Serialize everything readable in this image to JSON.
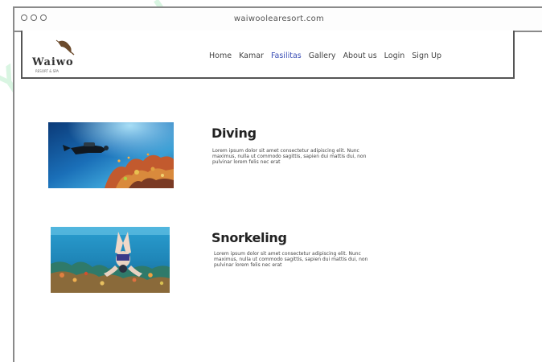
{
  "browser": {
    "url": "waiwoolearesort.com"
  },
  "header": {
    "logo_text": "Waiwo",
    "logo_tagline": "RESORT & SPA",
    "nav": [
      {
        "label": "Home"
      },
      {
        "label": "Kamar"
      },
      {
        "label": "Fasilitas"
      },
      {
        "label": "Gallery"
      },
      {
        "label": "About us"
      },
      {
        "label": "Login"
      },
      {
        "label": "Sign Up"
      }
    ],
    "active_nav": "Fasilitas",
    "active_color": "#3b4fb5"
  },
  "facilities": [
    {
      "title": "Diving",
      "description": "Lorem ipsum dolor sit amet consectetur adipiscing elit. Nunc maximus, nulla ut commodo sagittis, sapien dui mattis dui, non pulvinar lorem felis nec erat",
      "image": "underwater-diver-coral-reef"
    },
    {
      "title": "Snorkeling",
      "description": "Lorem ipsum dolor sit amet consectetur adipiscing elit. Nunc maximus, nulla ut commodo sagittis, sapien dui mattis dui, non pulvinar lorem felis nec erat",
      "image": "snorkeler-over-coral-reef"
    }
  ],
  "watermark": "YOU"
}
